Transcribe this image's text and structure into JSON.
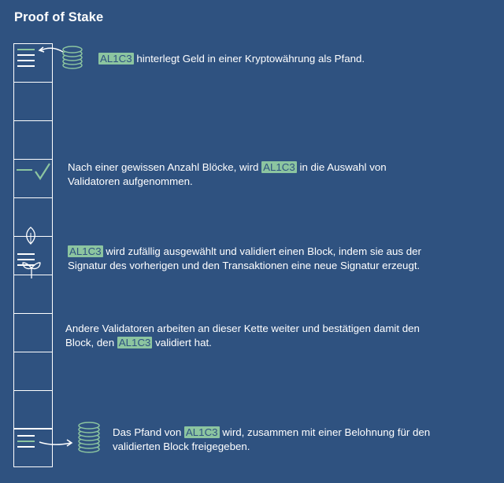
{
  "title": "Proof of Stake",
  "validator_tag": "AL1C3",
  "steps": [
    {
      "before": "",
      "after": " hinterlegt Geld in einer Kryptowährung als Pfand.",
      "line2": ""
    },
    {
      "before": "Nach einer gewissen Anzahl Blöcke, wird ",
      "after": " in die Auswahl von",
      "line2": "Validatoren aufgenommen."
    },
    {
      "before": "",
      "after": " wird zufällig ausgewählt und validiert einen Block, indem sie aus der",
      "line2": "Signatur des vorherigen und den Transaktionen eine neue Signatur erzeugt."
    },
    {
      "before": "Andere Validatoren arbeiten an dieser Kette weiter und bestätigen damit den",
      "after": "",
      "line2_before": "Block, den ",
      "line2_after": " validiert hat."
    },
    {
      "before": "Das Pfand von ",
      "after": " wird, zusammen mit einer Belohnung für den",
      "line2": "validierten Block freigegeben."
    }
  ],
  "colors": {
    "background": "#2f5280",
    "accent": "#8cc5a0",
    "line": "#ffffff"
  },
  "icons": [
    "coin-stack-icon",
    "checkmark-icon",
    "seedling-icon",
    "coin-stack-icon"
  ]
}
